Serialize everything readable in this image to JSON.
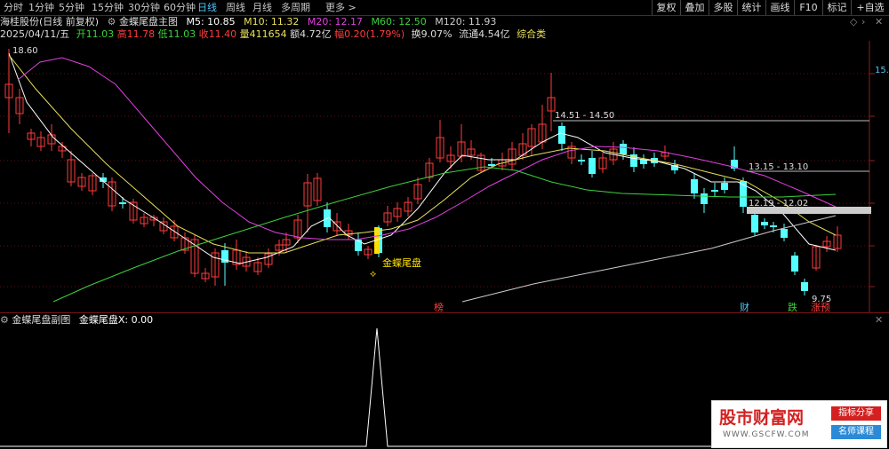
{
  "toolbar": {
    "tabs": [
      "分时",
      "1分钟",
      "5分钟",
      "15分钟",
      "30分钟",
      "60分钟",
      "日线",
      "周线",
      "月线",
      "多周期",
      "更多 >"
    ],
    "active_tab": "日线",
    "right_buttons": [
      "复权",
      "叠加",
      "多股",
      "统计",
      "画线",
      "F10",
      "标记",
      "+自选"
    ]
  },
  "header": {
    "stock": "海桂股份(日线 前复权)",
    "indicator": "金蝶尾盘主图",
    "ma5": "M5: 10.85",
    "ma10": "M10: 11.32",
    "ma20": "M20: 12.17",
    "ma60": "M60: 12.50",
    "ma120": "M120: 11.93",
    "date": "2025/04/11/五",
    "open_label": "开",
    "open": "11.03",
    "high_label": "高",
    "high": "11.78",
    "low_label": "低",
    "low": "11.03",
    "close_label": "收",
    "close": "11.40",
    "vol_label": "量",
    "vol": "411654",
    "amt_label": "额",
    "amt": "4.72亿",
    "chg_label": "幅",
    "chg": "0.20(1.79%)",
    "turn": "换9.07%",
    "float": "流通4.54亿",
    "sector": "综合类"
  },
  "main": {
    "price_labels": {
      "p1": "18.60",
      "p2": "14.51 - 14.50",
      "p3": "13.15 - 13.10",
      "p4": "12.19 - 12.02",
      "p5": "9.75"
    },
    "signal": "金蝶尾盘",
    "markers": [
      "榜",
      "财",
      "跌",
      "涨预"
    ],
    "axis_right": "15.0"
  },
  "sub": {
    "title": "金蝶尾盘副图",
    "value": "金蝶尾盘X: 0.00"
  },
  "watermark": {
    "title": "股市财富网",
    "url": "WWW.GSCFW.COM",
    "tag1": "指标分享",
    "tag2": "名师课程"
  },
  "colors": {
    "up": "#ff3b3b",
    "down": "#54ffff",
    "ma5": "#ffffff",
    "ma10": "#e8e05a",
    "ma20": "#e040e0",
    "ma60": "#3cd23c",
    "ma120": "#cccccc",
    "accent": "#4fc3f7"
  }
}
